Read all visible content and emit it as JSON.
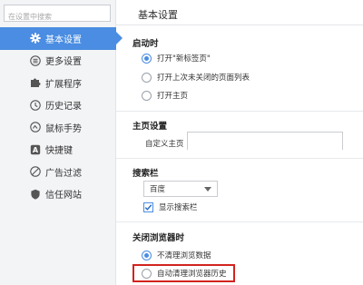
{
  "search": {
    "placeholder": "在设置中搜索"
  },
  "sidebar": {
    "items": [
      {
        "label": "基本设置",
        "icon": "gear-icon"
      },
      {
        "label": "更多设置",
        "icon": "list-icon"
      },
      {
        "label": "扩展程序",
        "icon": "puzzle-icon"
      },
      {
        "label": "历史记录",
        "icon": "clock-icon"
      },
      {
        "label": "鼠标手势",
        "icon": "gesture-icon"
      },
      {
        "label": "快捷键",
        "icon": "keyboard-a-icon"
      },
      {
        "label": "广告过滤",
        "icon": "block-icon"
      },
      {
        "label": "信任网站",
        "icon": "shield-icon"
      }
    ],
    "active_index": 0
  },
  "main": {
    "title": "基本设置",
    "startup": {
      "title": "启动时",
      "options": [
        "打开\"新标签页\"",
        "打开上次未关闭的页面列表",
        "打开主页"
      ],
      "selected_index": 0
    },
    "homepage": {
      "title": "主页设置",
      "label": "自定义主页",
      "value": ""
    },
    "search_bar": {
      "title": "搜索栏",
      "engine": "百度",
      "show_label": "显示搜索栏",
      "show_checked": true
    },
    "on_close": {
      "title": "关闭浏览器时",
      "options": [
        "不清理浏览数据",
        "自动清理浏览器历史"
      ],
      "selected_index": 0
    }
  },
  "colors": {
    "accent": "#4a8de2",
    "highlight": "#d2231e",
    "sidebar_bg": "#f3f4f6"
  }
}
